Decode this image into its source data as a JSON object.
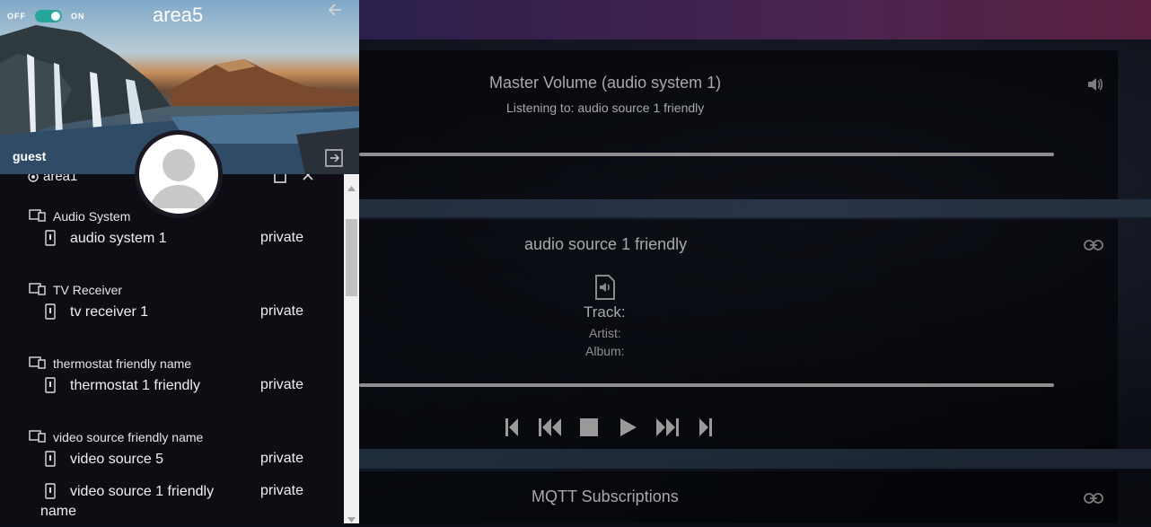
{
  "panel": {
    "toggle": {
      "off_label": "OFF",
      "on_label": "ON"
    },
    "area_title": "area5",
    "user_name": "guest",
    "area_row_label": "area1",
    "groups": [
      {
        "label": "Audio System",
        "items": [
          {
            "name": "audio system 1",
            "visibility": "private"
          }
        ]
      },
      {
        "label": "TV Receiver",
        "items": [
          {
            "name": "tv receiver 1",
            "visibility": "private"
          }
        ]
      },
      {
        "label": "thermostat friendly name",
        "items": [
          {
            "name": "thermostat 1 friendly",
            "visibility": "private"
          }
        ]
      },
      {
        "label": "video source friendly name",
        "items": [
          {
            "name": "video source 5",
            "visibility": "private"
          },
          {
            "name_line1": "video source 1 friendly",
            "name_line2": "name",
            "visibility": "private"
          }
        ]
      }
    ]
  },
  "master_volume": {
    "title": "Master Volume (audio system 1)",
    "subtitle": "Listening to: audio source 1 friendly",
    "icon": "volume-icon"
  },
  "now_playing": {
    "title": "audio source 1 friendly",
    "track_label": "Track:",
    "artist_label": "Artist:",
    "album_label": "Album:",
    "icon": "link-icon"
  },
  "mqtt": {
    "title": "MQTT Subscriptions",
    "icon": "link-icon"
  },
  "colors": {
    "accent_teal": "#26a69a",
    "top_bar_purple": "#4a2450"
  }
}
